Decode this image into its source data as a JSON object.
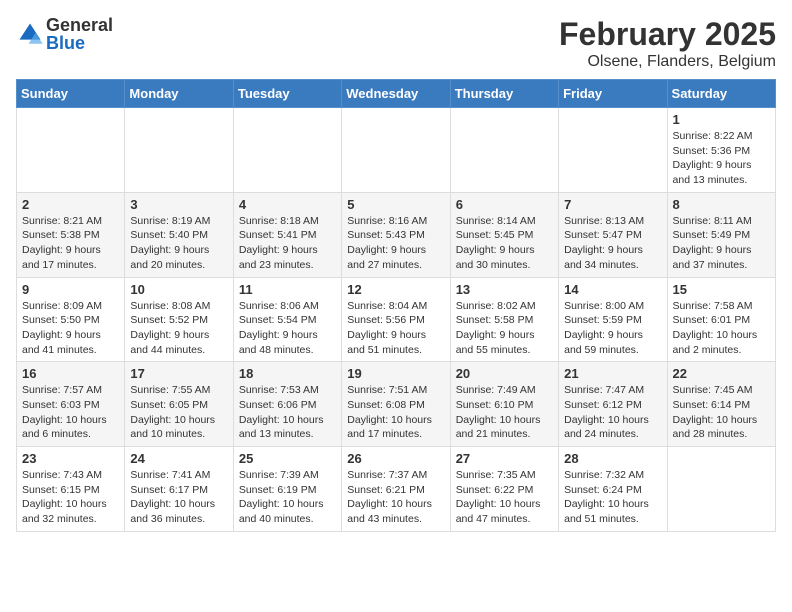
{
  "header": {
    "logo_general": "General",
    "logo_blue": "Blue",
    "month_title": "February 2025",
    "location": "Olsene, Flanders, Belgium"
  },
  "days_of_week": [
    "Sunday",
    "Monday",
    "Tuesday",
    "Wednesday",
    "Thursday",
    "Friday",
    "Saturday"
  ],
  "weeks": [
    [
      {
        "day": "",
        "info": ""
      },
      {
        "day": "",
        "info": ""
      },
      {
        "day": "",
        "info": ""
      },
      {
        "day": "",
        "info": ""
      },
      {
        "day": "",
        "info": ""
      },
      {
        "day": "",
        "info": ""
      },
      {
        "day": "1",
        "info": "Sunrise: 8:22 AM\nSunset: 5:36 PM\nDaylight: 9 hours and 13 minutes."
      }
    ],
    [
      {
        "day": "2",
        "info": "Sunrise: 8:21 AM\nSunset: 5:38 PM\nDaylight: 9 hours and 17 minutes."
      },
      {
        "day": "3",
        "info": "Sunrise: 8:19 AM\nSunset: 5:40 PM\nDaylight: 9 hours and 20 minutes."
      },
      {
        "day": "4",
        "info": "Sunrise: 8:18 AM\nSunset: 5:41 PM\nDaylight: 9 hours and 23 minutes."
      },
      {
        "day": "5",
        "info": "Sunrise: 8:16 AM\nSunset: 5:43 PM\nDaylight: 9 hours and 27 minutes."
      },
      {
        "day": "6",
        "info": "Sunrise: 8:14 AM\nSunset: 5:45 PM\nDaylight: 9 hours and 30 minutes."
      },
      {
        "day": "7",
        "info": "Sunrise: 8:13 AM\nSunset: 5:47 PM\nDaylight: 9 hours and 34 minutes."
      },
      {
        "day": "8",
        "info": "Sunrise: 8:11 AM\nSunset: 5:49 PM\nDaylight: 9 hours and 37 minutes."
      }
    ],
    [
      {
        "day": "9",
        "info": "Sunrise: 8:09 AM\nSunset: 5:50 PM\nDaylight: 9 hours and 41 minutes."
      },
      {
        "day": "10",
        "info": "Sunrise: 8:08 AM\nSunset: 5:52 PM\nDaylight: 9 hours and 44 minutes."
      },
      {
        "day": "11",
        "info": "Sunrise: 8:06 AM\nSunset: 5:54 PM\nDaylight: 9 hours and 48 minutes."
      },
      {
        "day": "12",
        "info": "Sunrise: 8:04 AM\nSunset: 5:56 PM\nDaylight: 9 hours and 51 minutes."
      },
      {
        "day": "13",
        "info": "Sunrise: 8:02 AM\nSunset: 5:58 PM\nDaylight: 9 hours and 55 minutes."
      },
      {
        "day": "14",
        "info": "Sunrise: 8:00 AM\nSunset: 5:59 PM\nDaylight: 9 hours and 59 minutes."
      },
      {
        "day": "15",
        "info": "Sunrise: 7:58 AM\nSunset: 6:01 PM\nDaylight: 10 hours and 2 minutes."
      }
    ],
    [
      {
        "day": "16",
        "info": "Sunrise: 7:57 AM\nSunset: 6:03 PM\nDaylight: 10 hours and 6 minutes."
      },
      {
        "day": "17",
        "info": "Sunrise: 7:55 AM\nSunset: 6:05 PM\nDaylight: 10 hours and 10 minutes."
      },
      {
        "day": "18",
        "info": "Sunrise: 7:53 AM\nSunset: 6:06 PM\nDaylight: 10 hours and 13 minutes."
      },
      {
        "day": "19",
        "info": "Sunrise: 7:51 AM\nSunset: 6:08 PM\nDaylight: 10 hours and 17 minutes."
      },
      {
        "day": "20",
        "info": "Sunrise: 7:49 AM\nSunset: 6:10 PM\nDaylight: 10 hours and 21 minutes."
      },
      {
        "day": "21",
        "info": "Sunrise: 7:47 AM\nSunset: 6:12 PM\nDaylight: 10 hours and 24 minutes."
      },
      {
        "day": "22",
        "info": "Sunrise: 7:45 AM\nSunset: 6:14 PM\nDaylight: 10 hours and 28 minutes."
      }
    ],
    [
      {
        "day": "23",
        "info": "Sunrise: 7:43 AM\nSunset: 6:15 PM\nDaylight: 10 hours and 32 minutes."
      },
      {
        "day": "24",
        "info": "Sunrise: 7:41 AM\nSunset: 6:17 PM\nDaylight: 10 hours and 36 minutes."
      },
      {
        "day": "25",
        "info": "Sunrise: 7:39 AM\nSunset: 6:19 PM\nDaylight: 10 hours and 40 minutes."
      },
      {
        "day": "26",
        "info": "Sunrise: 7:37 AM\nSunset: 6:21 PM\nDaylight: 10 hours and 43 minutes."
      },
      {
        "day": "27",
        "info": "Sunrise: 7:35 AM\nSunset: 6:22 PM\nDaylight: 10 hours and 47 minutes."
      },
      {
        "day": "28",
        "info": "Sunrise: 7:32 AM\nSunset: 6:24 PM\nDaylight: 10 hours and 51 minutes."
      },
      {
        "day": "",
        "info": ""
      }
    ]
  ]
}
